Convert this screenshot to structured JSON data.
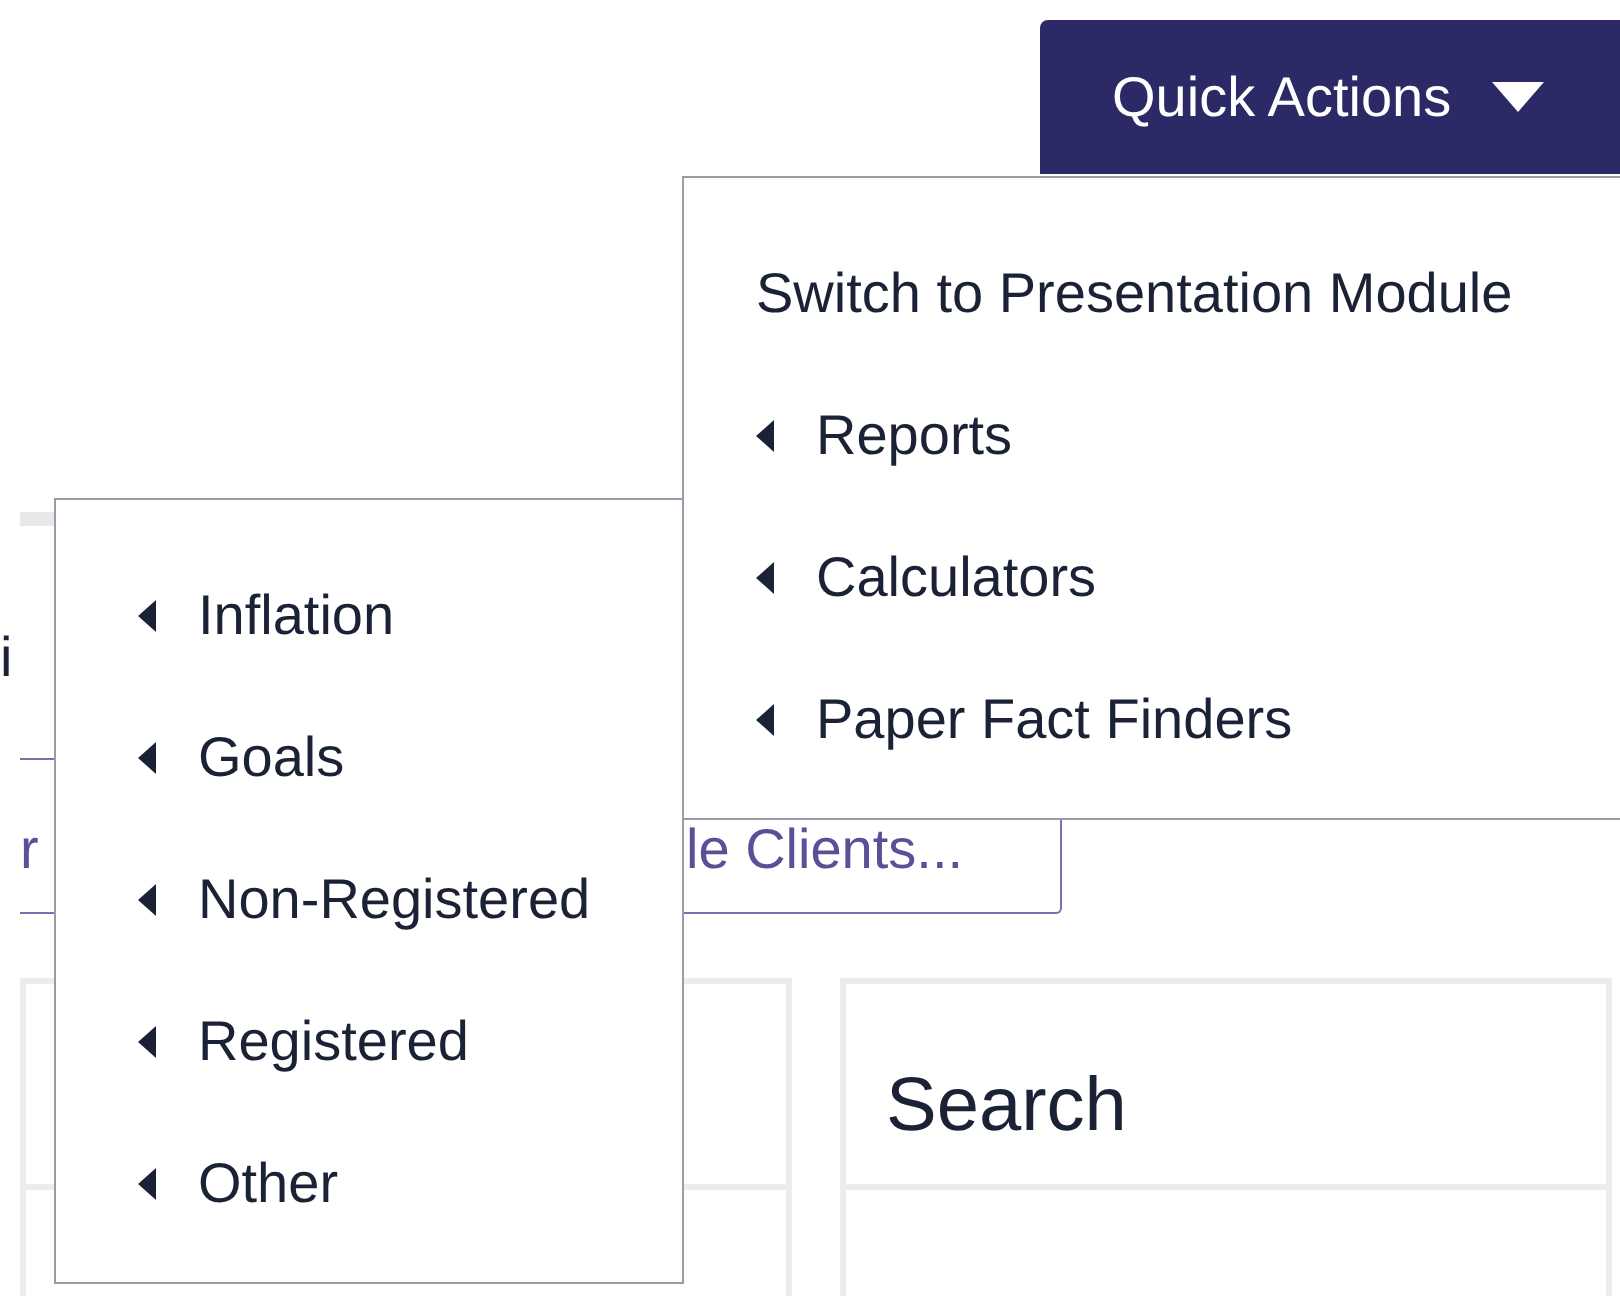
{
  "quick_actions": {
    "label": "Quick Actions",
    "expanded": true
  },
  "menu": {
    "items": [
      {
        "label": "Switch to Presentation Module",
        "kind": "action"
      },
      {
        "label": "Reports",
        "kind": "submenu"
      },
      {
        "label": "Calculators",
        "kind": "submenu"
      },
      {
        "label": "Paper Fact Finders",
        "kind": "submenu"
      }
    ]
  },
  "submenu": {
    "items": [
      {
        "label": "Inflation",
        "kind": "submenu"
      },
      {
        "label": "Goals",
        "kind": "submenu"
      },
      {
        "label": "Non-Registered",
        "kind": "submenu"
      },
      {
        "label": "Registered",
        "kind": "submenu"
      },
      {
        "label": "Other",
        "kind": "submenu"
      }
    ]
  },
  "background": {
    "heading_fragment": "i",
    "tabs": [
      {
        "label": "r"
      },
      {
        "label": "le Clients..."
      }
    ],
    "panels": [
      {
        "kind": "blank"
      },
      {
        "kind": "titled",
        "title": "Search"
      }
    ]
  }
}
